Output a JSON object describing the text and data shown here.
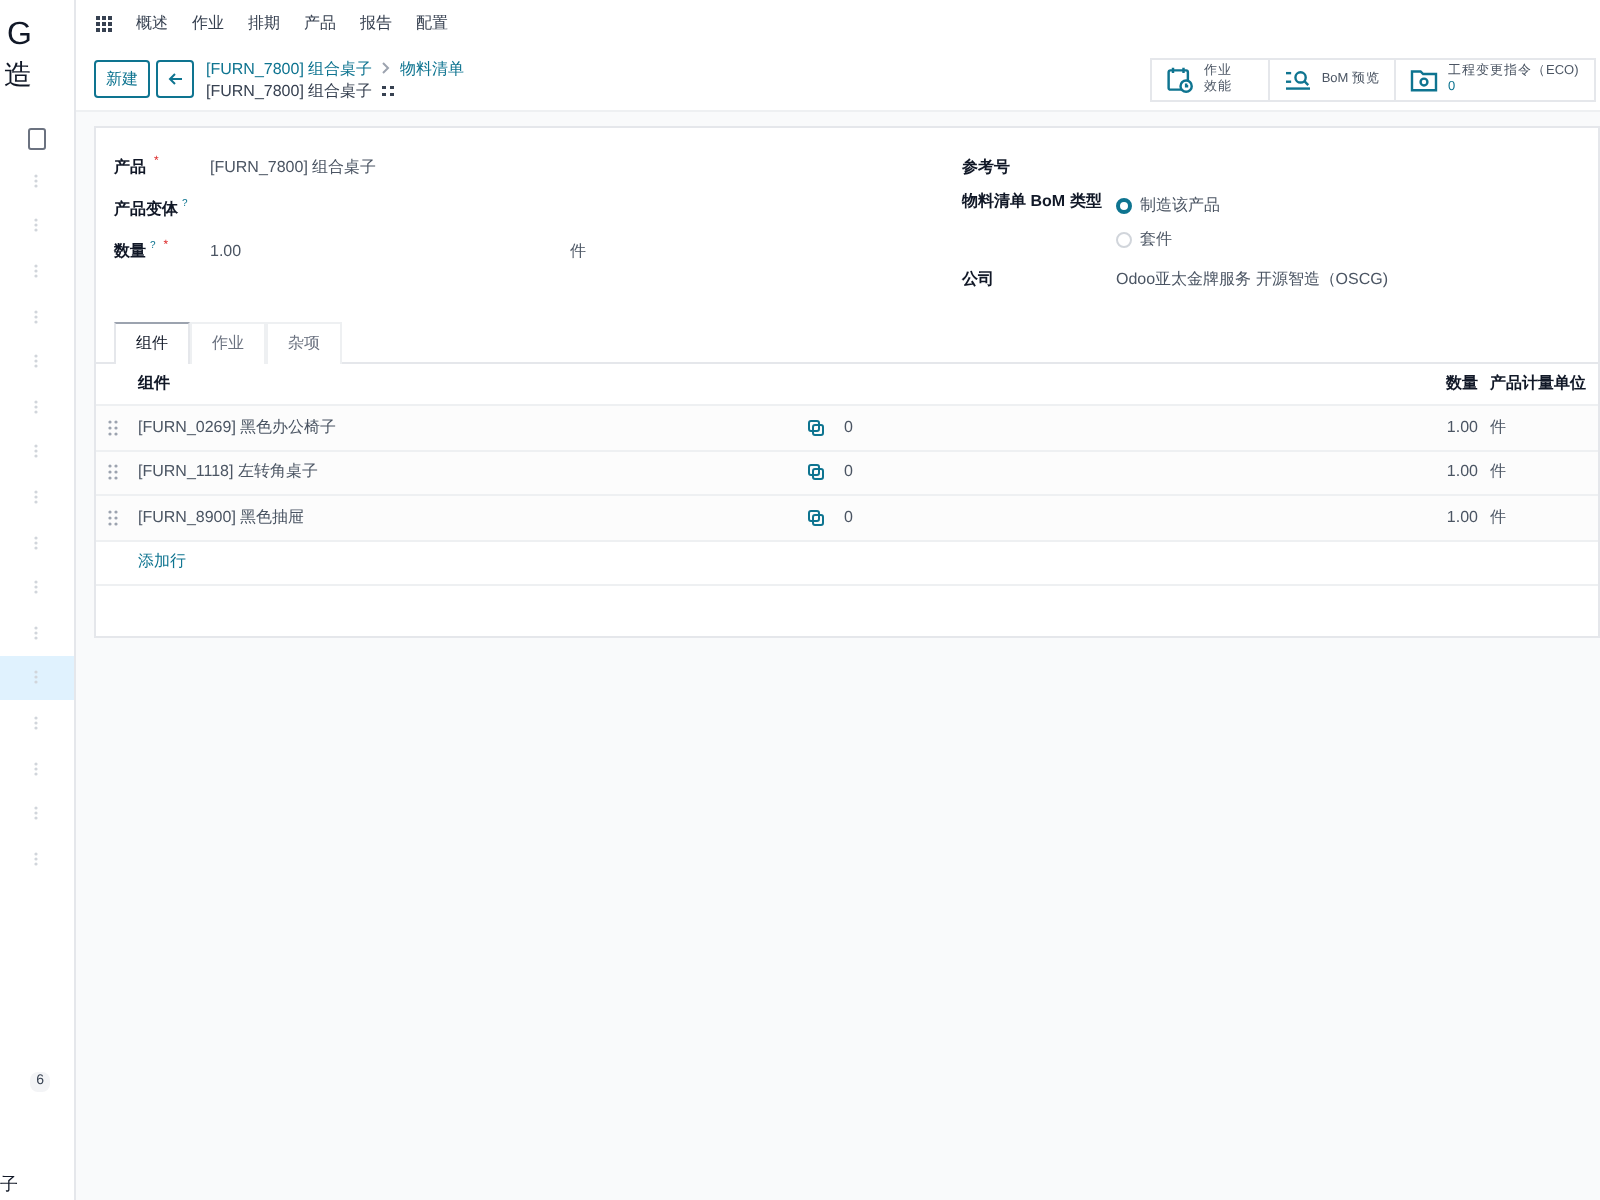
{
  "sidebar": {
    "title": "G",
    "subtitle": "造",
    "items": [
      {
        "selected": false
      },
      {
        "selected": false
      },
      {
        "selected": false
      },
      {
        "selected": false
      },
      {
        "selected": false
      },
      {
        "selected": false
      },
      {
        "selected": false
      },
      {
        "selected": false
      },
      {
        "selected": false
      },
      {
        "selected": false
      },
      {
        "selected": false
      },
      {
        "selected": true
      },
      {
        "selected": false
      },
      {
        "selected": false
      },
      {
        "selected": false
      },
      {
        "selected": false
      }
    ],
    "badge": "6",
    "footer_text": "子"
  },
  "menu": [
    "概述",
    "作业",
    "排期",
    "产品",
    "报告",
    "配置"
  ],
  "new_button": "新建",
  "breadcrumb": {
    "parent": "[FURN_7800] 组合桌子",
    "current": "物料清单",
    "record": "[FURN_7800] 组合桌子"
  },
  "smart_buttons": [
    {
      "kind": "calendar",
      "label_lines": [
        "作业",
        "效能"
      ]
    },
    {
      "kind": "search",
      "label_lines": [
        "BoM 预览"
      ]
    },
    {
      "kind": "folder",
      "label_lines": [
        "工程变更指令（ECO)"
      ],
      "count": "0"
    }
  ],
  "form": {
    "left": [
      {
        "label": "产品",
        "required_mark": "*",
        "value": "[FURN_7800] 组合桌子"
      },
      {
        "label": "产品变体",
        "help": "?"
      },
      {
        "label": "数量",
        "help": "?",
        "required_mark": "*",
        "value": "1.00",
        "unit": "件"
      }
    ],
    "reference_label": "参考号",
    "bom_type": {
      "label": "物料清单 BoM 类型",
      "options": [
        {
          "label": "制造该产品",
          "selected": true
        },
        {
          "label": "套件",
          "selected": false
        }
      ]
    },
    "company": {
      "label": "公司",
      "value": "Odoo亚太金牌服务 开源智造（OSCG)"
    }
  },
  "tabs": [
    {
      "label": "组件",
      "selected": true
    },
    {
      "label": "作业",
      "selected": false
    },
    {
      "label": "杂项",
      "selected": false
    }
  ],
  "table": {
    "columns": [
      "组件",
      "数量",
      "产品计量单位"
    ],
    "rows": [
      {
        "component": "[FURN_0269] 黑色办公椅子",
        "count": "0",
        "quantity": "1.00",
        "uom": "件"
      },
      {
        "component": "[FURN_1118] 左转角桌子",
        "count": "0",
        "quantity": "1.00",
        "uom": "件"
      },
      {
        "component": "[FURN_8900] 黑色抽屉",
        "count": "0",
        "quantity": "1.00",
        "uom": "件"
      }
    ],
    "add_line": "添加行"
  }
}
